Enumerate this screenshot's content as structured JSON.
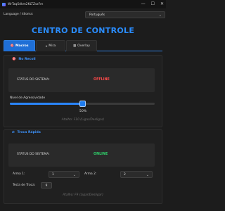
{
  "window": {
    "title": "WrTaqSdkm2KLTZszFm",
    "controls": {
      "minimize": "—",
      "maximize": "☐",
      "close": "✕"
    }
  },
  "language": {
    "label": "Language / Idioma:",
    "selected": "Português"
  },
  "main_title": "CENTRO DE CONTROLE",
  "tabs": [
    {
      "icon": "🎯",
      "label": "Macros",
      "active": true
    },
    {
      "icon": "⌖",
      "label": "Mira",
      "active": false
    },
    {
      "icon": "▦",
      "label": "Overlay",
      "active": false
    }
  ],
  "no_recoil": {
    "icon": "🎯",
    "title": "No Recoil",
    "status_label": "STATUS DO SISTEMA:",
    "status_value": "OFFLINE",
    "aggressiveness_label": "Nível de Agressividade",
    "aggressiveness_value": "50%",
    "aggressiveness_level": 0.5,
    "hotkey_hint": "Atalho: F10 (Ligar/Desligar)"
  },
  "quick_swap": {
    "icon": "⇄",
    "title": "Troca Rápida",
    "status_label": "STATUS DO SISTEMA:",
    "status_value": "ONLINE",
    "weapon1_label": "Arma 1:",
    "weapon1_value": "1",
    "weapon2_label": "Arma 2:",
    "weapon2_value": "2",
    "swap_key_label": "Tecla de Troca:",
    "swap_key_value": "q",
    "hotkey_hint": "Atalho: F9 (Ligar/Desligar)"
  },
  "colors": {
    "accent": "#2a8dff",
    "offline": "#ff4a4a",
    "online": "#2fd06a",
    "background": "#1c1c1c"
  }
}
